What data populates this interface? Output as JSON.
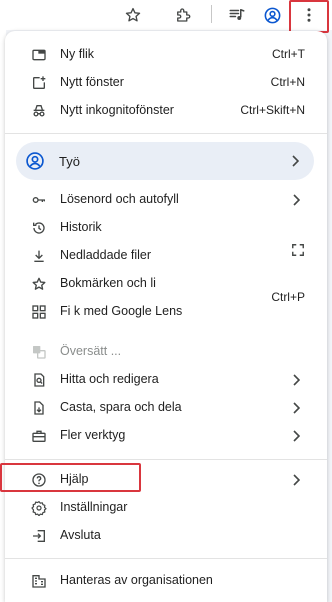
{
  "toolbar": {
    "icons": [
      "star-icon",
      "extensions-icon",
      "media-control-icon",
      "profile-icon",
      "more-vert-icon"
    ]
  },
  "menu": {
    "group1": [
      {
        "label": "Ny flik",
        "shortcut": "Ctrl+T",
        "icon": "new-tab-icon"
      },
      {
        "label": "Nytt fönster",
        "shortcut": "Ctrl+N",
        "icon": "new-window-icon"
      },
      {
        "label": "Nytt inkognitofönster",
        "shortcut": "Ctrl+Skift+N",
        "icon": "incognito-icon"
      }
    ],
    "profile": {
      "label": "Työ",
      "icon": "account-circle-icon"
    },
    "group2": [
      {
        "label": "Lösenord och autofyll",
        "icon": "key-icon",
        "submenu": true
      },
      {
        "label": "Historik",
        "icon": "history-icon",
        "submenu": true
      },
      {
        "label": "Nedladdade filer",
        "icon": "download-icon",
        "submenu": false
      },
      {
        "label": "Bokmärken och li",
        "icon": "bookmark-star-icon",
        "submenu": false
      },
      {
        "label": "Fi           k med Google Lens",
        "icon": "google-lens-icon",
        "submenu": false
      },
      {
        "label": "Översätt ...",
        "icon": "translate-icon",
        "submenu": false
      },
      {
        "label": "Hitta och redigera",
        "icon": "find-edit-icon",
        "submenu": true
      },
      {
        "label": "Casta, spara och dela",
        "icon": "cast-save-share-icon",
        "submenu": true
      },
      {
        "label": "Fler verktyg",
        "icon": "toolbox-icon",
        "submenu": true
      }
    ],
    "print_shortcut": "Ctrl+P",
    "zoom_icon": "fullscreen-icon",
    "group3": [
      {
        "label": "Hjälp",
        "icon": "help-icon",
        "submenu": true
      },
      {
        "label": "Inställningar",
        "icon": "settings-gear-icon",
        "submenu": false
      },
      {
        "label": "Avsluta",
        "icon": "exit-icon",
        "submenu": false
      }
    ],
    "managed": {
      "label": "Hanteras av organisationen",
      "icon": "business-icon"
    }
  },
  "colors": {
    "highlight_border": "#d9363e",
    "profile_bg": "#e9eef6",
    "icon": "#444746",
    "text": "#1f1f1f"
  }
}
